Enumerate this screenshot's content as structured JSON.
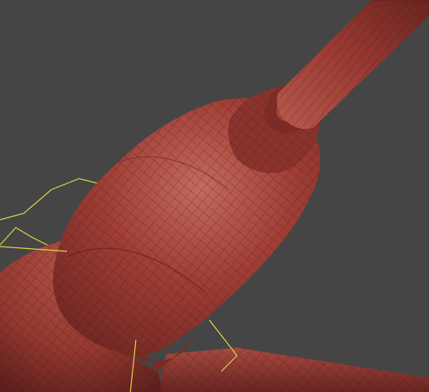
{
  "viewport": {
    "background": "#454545",
    "shading": "smooth-shaded-with-wireframe-overlay"
  },
  "model": {
    "material_color": "#9a3a32",
    "highlight_color": "#c86a5e",
    "shadow_color": "#5a1f1c",
    "wire_color": "#3a1512",
    "parts": [
      "rod",
      "collar",
      "neck",
      "bottle-body",
      "base-flare",
      "base-hub",
      "side-beam"
    ]
  },
  "helpers": {
    "spline_color": "#e2d84a",
    "spline_count": 2
  }
}
